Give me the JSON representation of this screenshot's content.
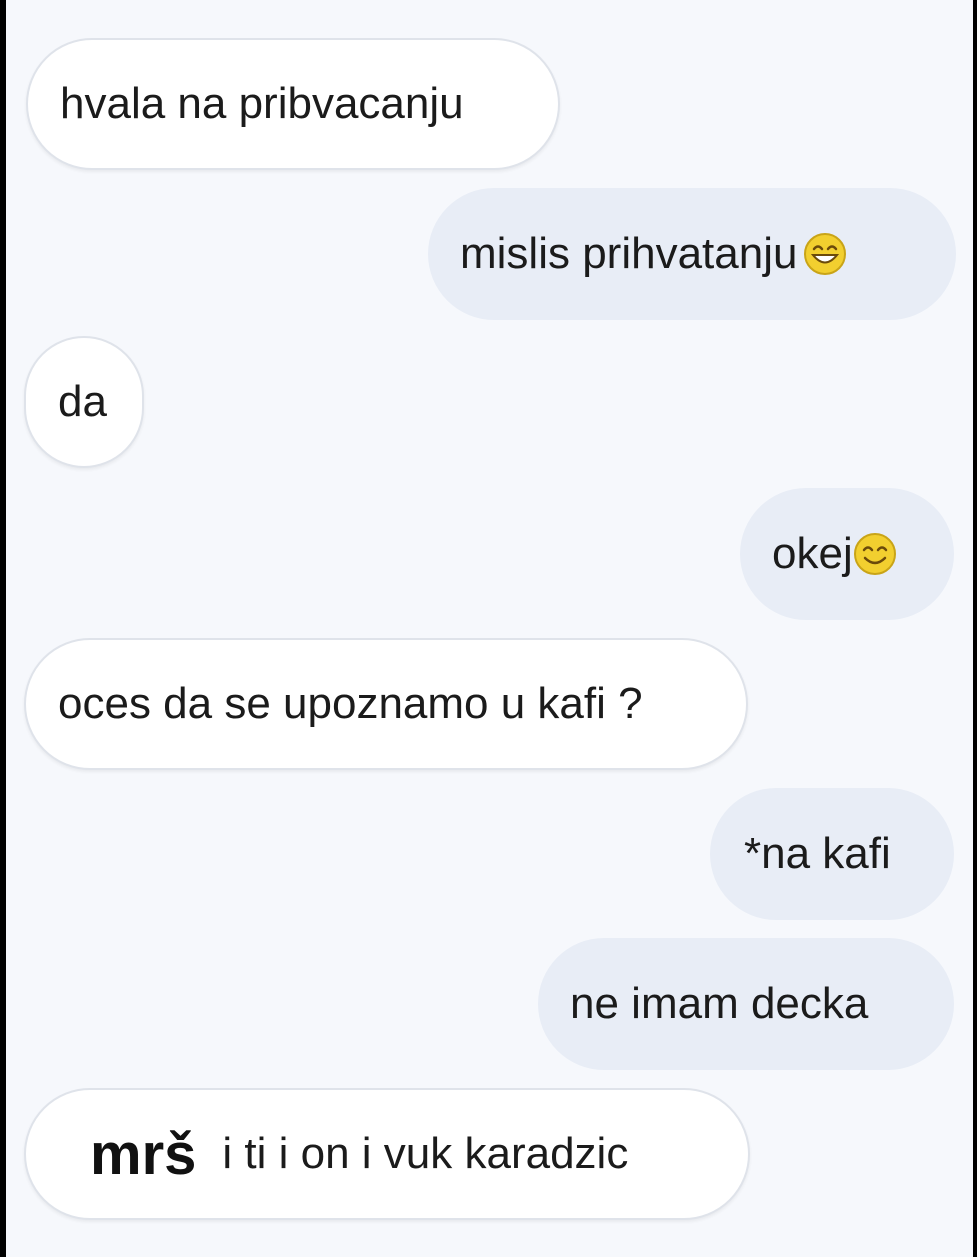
{
  "messages": [
    {
      "side": "in",
      "text": "hvala na pribvacanju"
    },
    {
      "side": "out",
      "text": "mislis prihvatanju",
      "emoji": "grinning-face-icon"
    },
    {
      "side": "in",
      "text": "da"
    },
    {
      "side": "out",
      "text": "okej",
      "emoji": "smiling-face-icon"
    },
    {
      "side": "in",
      "text": "oces da se upoznamo u kafi ?"
    },
    {
      "side": "out",
      "text": "*na kafi"
    },
    {
      "side": "out",
      "text": "ne imam decka"
    },
    {
      "side": "in",
      "prefix": "mrš",
      "text": "i ti i on i vuk karadzic"
    }
  ],
  "colors": {
    "background": "#f6f8fc",
    "incoming_bubble": "#ffffff",
    "outgoing_bubble": "#e8edf6",
    "emoji": "#f2cf2f"
  }
}
